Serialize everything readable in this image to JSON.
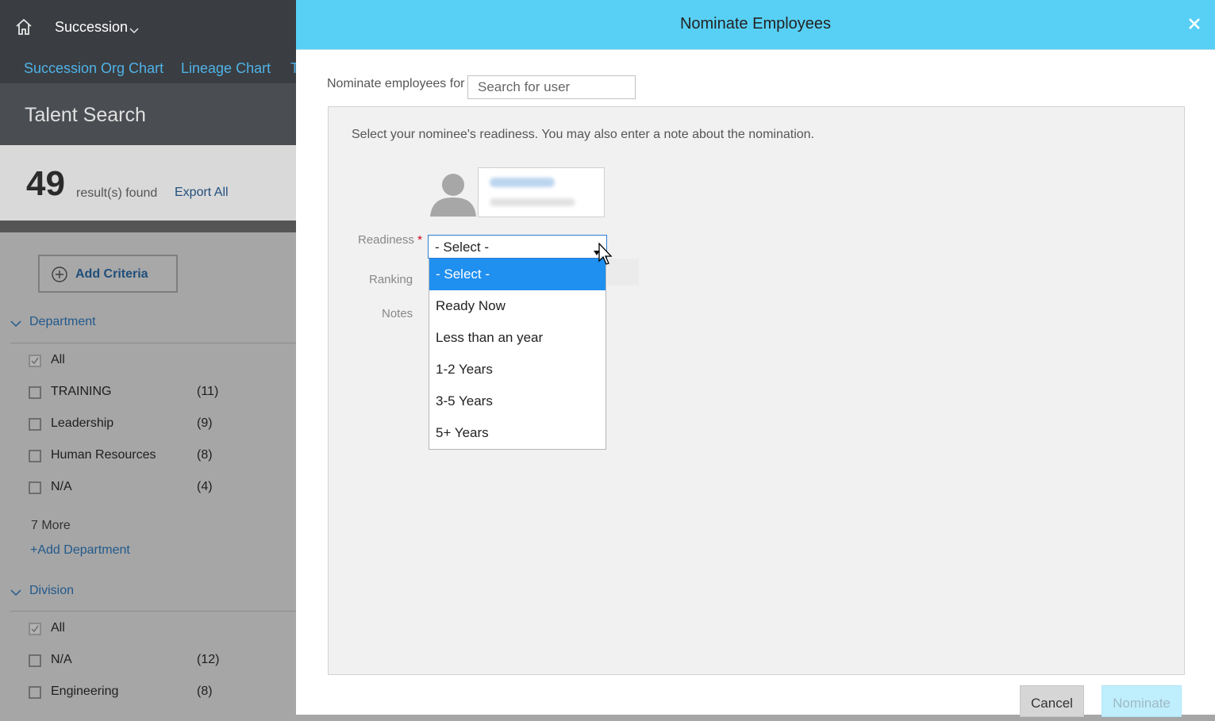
{
  "shell": {
    "app_name": "Succession",
    "subnav": [
      "Succession Org Chart",
      "Lineage Chart",
      "T"
    ]
  },
  "talent_search": {
    "title": "Talent Search",
    "results_count": "49",
    "results_label": "result(s) found",
    "export_all": "Export All",
    "add_criteria": "Add Criteria",
    "department": {
      "title": "Department",
      "items": [
        {
          "label": "All",
          "count": "",
          "checked": true
        },
        {
          "label": "TRAINING",
          "count": "(11)",
          "checked": false
        },
        {
          "label": "Leadership",
          "count": "(9)",
          "checked": false
        },
        {
          "label": "Human Resources",
          "count": "(8)",
          "checked": false
        },
        {
          "label": "N/A",
          "count": "(4)",
          "checked": false
        }
      ],
      "more": "7 More",
      "add": "+Add Department"
    },
    "division": {
      "title": "Division",
      "items": [
        {
          "label": "All",
          "count": "",
          "checked": true
        },
        {
          "label": "N/A",
          "count": "(12)",
          "checked": false
        },
        {
          "label": "Engineering",
          "count": "(8)",
          "checked": false
        }
      ]
    }
  },
  "modal": {
    "title": "Nominate Employees",
    "nominate_for_label": "Nominate employees for",
    "search_placeholder": "Search for user",
    "instructions": "Select your nominee's readiness. You may also enter a note about the nomination.",
    "readiness_label": "Readiness",
    "required_mark": "*",
    "ranking_label": "Ranking",
    "notes_label": "Notes",
    "readiness_selected": "- Select -",
    "readiness_options": [
      "- Select -",
      "Ready Now",
      "Less than an year",
      "1-2 Years",
      "3-5 Years",
      "5+ Years"
    ],
    "cancel": "Cancel",
    "nominate": "Nominate"
  },
  "colors": {
    "modal_header": "#58d0f5",
    "link_blue": "#22598c",
    "selected_option": "#1f8ff0",
    "required": "#d0021b"
  }
}
